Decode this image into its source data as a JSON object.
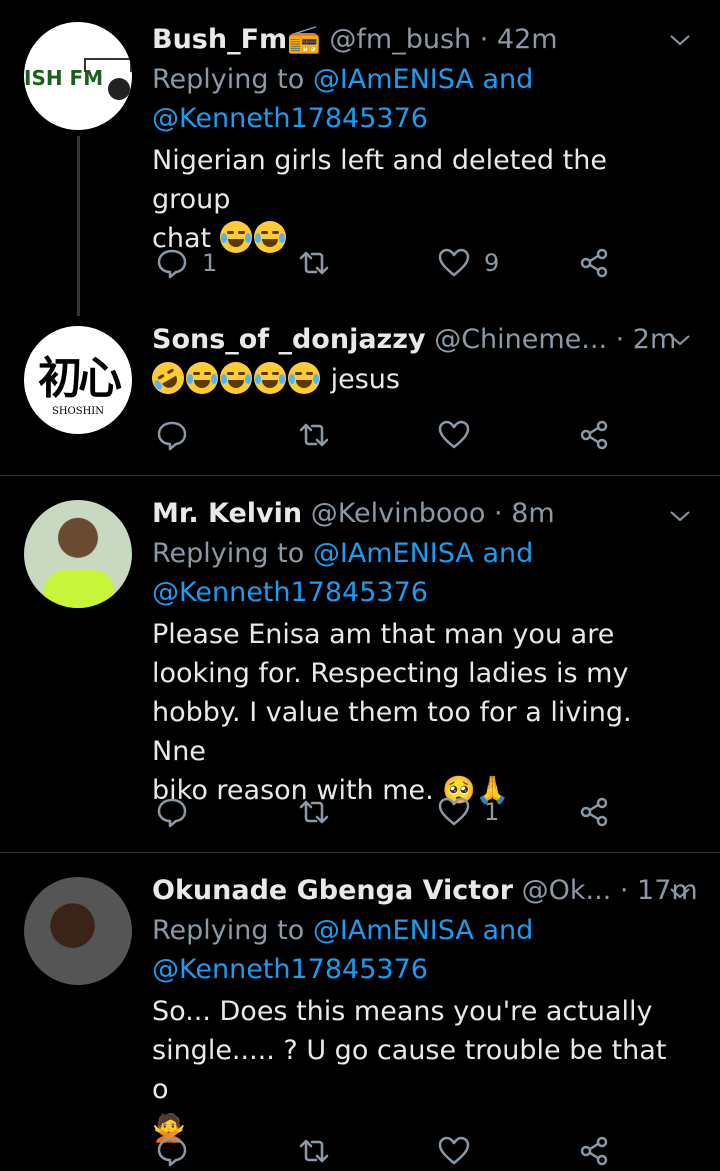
{
  "tweets": [
    {
      "name": "Bush_Fm📻",
      "handle": "@fm_bush",
      "time": "· 42m",
      "replying_prefix": "Replying to ",
      "replying_to": "@IAmENISA and",
      "replying_to2": "@Kenneth17845376",
      "text_line1": "Nigerian girls left and deleted the group",
      "text_line2": "chat",
      "reply_count": "1",
      "like_count": "9",
      "avatar_text": "ISH FM"
    },
    {
      "name": "Sons_of _donjazzy",
      "handle": "@Chineme...",
      "time": "· 2m",
      "text": "jesus",
      "avatar_text": "初心",
      "avatar_sub": "SHOSHIN"
    },
    {
      "name": "Mr. Kelvin",
      "handle": "@Kelvinbooo",
      "time": "· 8m",
      "replying_prefix": "Replying to ",
      "replying_to": "@IAmENISA and",
      "replying_to2": "@Kenneth17845376",
      "text_lines": [
        "Please Enisa am that man you are",
        "looking for. Respecting ladies is my",
        "hobby. I value them too for a living. Nne",
        "biko reason with me. 🥺🙏"
      ],
      "like_count": "1"
    },
    {
      "name": "Okunade Gbenga Victor",
      "handle": "@Ok...",
      "time": "· 17m",
      "replying_prefix": "Replying to ",
      "replying_to": "@IAmENISA and",
      "replying_to2": "@Kenneth17845376",
      "text_lines": [
        "So... Does this means you're actually",
        "single..... ?  U go cause trouble be that o",
        "🙅"
      ]
    }
  ],
  "colors": {
    "background": "#000000",
    "link": "#1d9bf0",
    "muted": "#8b98a5",
    "text": "#e7e9ea"
  }
}
